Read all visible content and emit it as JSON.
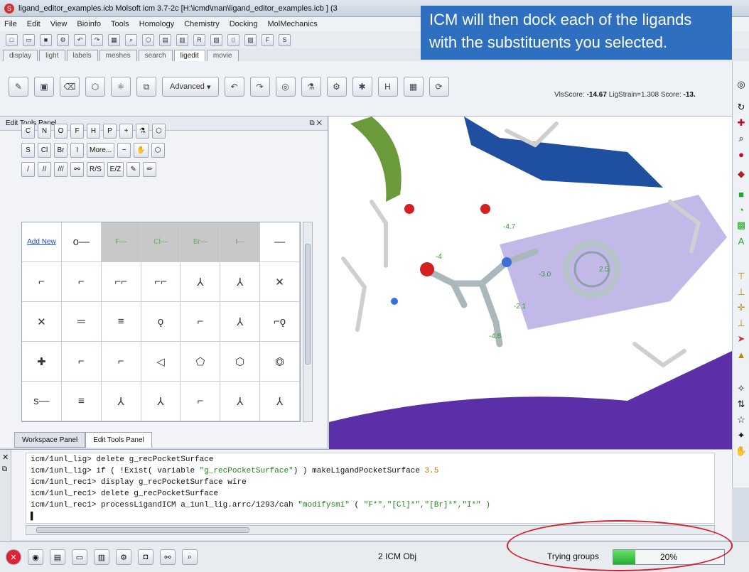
{
  "window": {
    "title": "ligand_editor_examples.icb Molsoft icm 3.7-2c  [H:\\icmd\\man\\ligand_editor_examples.icb ] (3"
  },
  "menu": [
    "File",
    "Edit",
    "View",
    "Bioinfo",
    "Tools",
    "Homology",
    "Chemistry",
    "Docking",
    "MolMechanics"
  ],
  "view_tabs": [
    "display",
    "light",
    "labels",
    "meshes",
    "search",
    "ligedit",
    "movie"
  ],
  "toolbar": {
    "advanced_label": "Advanced"
  },
  "score_text": {
    "prefix": "VlsScore: ",
    "vls": "-14.67",
    "mid": " LigStrain=1.308 Score: ",
    "score": "-13."
  },
  "callout": {
    "line1": "ICM will then dock each of the ligands",
    "line2": "with the substituents you selected."
  },
  "edit_panel": {
    "title": "Edit Tools Panel",
    "row1": [
      "C",
      "N",
      "O",
      "F",
      "H",
      "P",
      "+"
    ],
    "row2": [
      "S",
      "Cl",
      "Br",
      "I",
      "More...",
      "−"
    ],
    "row3_labels": [
      "R/S",
      "E/Z"
    ],
    "add_new": "Add New"
  },
  "panel_tabs": [
    "Workspace Panel",
    "Edit Tools Panel"
  ],
  "terminal": {
    "lines": [
      {
        "prompt": "icm/1unl_lig> ",
        "cmd": "delete g_recPocketSurface"
      },
      {
        "prompt": "icm/1unl_lig> ",
        "cmd": "if ( !Exist( variable ",
        "str": "\"g_recPocketSurface\"",
        "tail": ") ) makeLigandPocketSurface ",
        "num": "3.5"
      },
      {
        "prompt": "icm/1unl_rec1> ",
        "cmd": "display g_recPocketSurface wire"
      },
      {
        "prompt": "icm/1unl_rec1> ",
        "cmd": "delete g_recPocketSurface"
      },
      {
        "prompt": "icm/1unl_rec1> ",
        "cmd": "processLigandICM a_1unl_lig.arrc/1293/cah ",
        "str": "\"modifysmi\"",
        "tail": " ( ",
        "num": "\"F*\",\"[Cl]*\",\"[Br]*\",\"I*\" )"
      }
    ]
  },
  "status": {
    "obj_count": "2 ICM Obj",
    "trying": "Trying groups",
    "progress_text": "20%",
    "progress_fraction": 0.2
  },
  "colors": {
    "callout": "#2f6fc0",
    "progress": "#1fae2c",
    "highlight_circle": "#d0202a"
  }
}
